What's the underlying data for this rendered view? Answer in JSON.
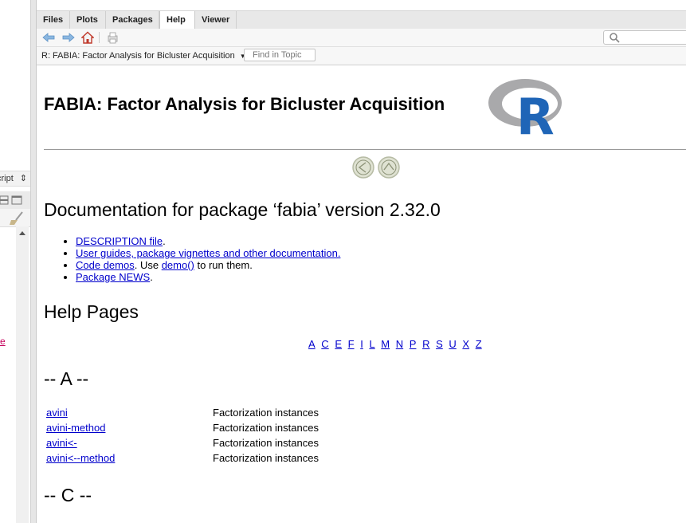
{
  "left_pane": {
    "selector_text": "cript",
    "fragment_link": "e"
  },
  "tabs": [
    {
      "label": "Files"
    },
    {
      "label": "Plots"
    },
    {
      "label": "Packages"
    },
    {
      "label": "Help",
      "active": true
    },
    {
      "label": "Viewer"
    }
  ],
  "toolbar": {
    "icons": [
      "back-arrow-icon",
      "forward-arrow-icon",
      "home-icon",
      "print-icon",
      "search-icon"
    ],
    "search_placeholder": ""
  },
  "topic_bar": {
    "current_topic": "R: FABIA: Factor Analysis for Bicluster Acquisition",
    "find_placeholder": "Find in Topic"
  },
  "page": {
    "title": "FABIA: Factor Analysis for Bicluster Acquisition",
    "logo_letter": "R",
    "doc_heading": "Documentation for package ‘fabia’ version 2.32.0",
    "links": [
      {
        "link": "DESCRIPTION file",
        "rest": "."
      },
      {
        "link": "User guides, package vignettes and other documentation.",
        "rest": ""
      },
      {
        "link": "Code demos",
        "rest": ". Use ",
        "link2": "demo()",
        "rest2": " to run them."
      },
      {
        "link": "Package NEWS",
        "rest": "."
      }
    ],
    "help_heading": "Help Pages",
    "letters": [
      "A",
      "C",
      "E",
      "F",
      "I",
      "L",
      "M",
      "N",
      "P",
      "R",
      "S",
      "U",
      "X",
      "Z"
    ],
    "section_a": "-- A --",
    "section_c": "-- C --",
    "entries": [
      {
        "name": "avini",
        "desc": "Factorization instances"
      },
      {
        "name": "avini-method",
        "desc": "Factorization instances"
      },
      {
        "name": "avini<-",
        "desc": "Factorization instances"
      },
      {
        "name": "avini<--method",
        "desc": "Factorization instances"
      }
    ]
  },
  "colors": {
    "link": "#0000cc",
    "tab_bar": "#e8e8e8",
    "logo_blue": "#1f65b7",
    "logo_grey": "#a9a9ab"
  }
}
